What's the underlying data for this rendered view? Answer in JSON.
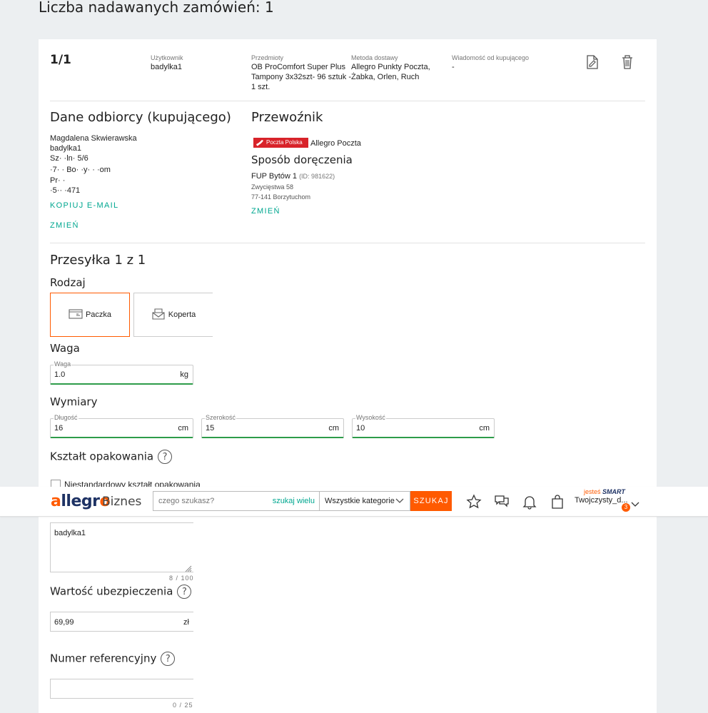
{
  "page_title": "Liczba nadawanych zamówień: 1",
  "order": {
    "index": "1/1",
    "user_label": "Użytkownik",
    "user_value": "badylka1",
    "items_label": "Przedmioty",
    "items_value_1": "OB ProComfort Super Plus",
    "items_value_2": "Tampony 3x32szt- 96 sztuk -",
    "items_value_3": "1 szt.",
    "delivery_label": "Metoda dostawy",
    "delivery_value_1": "Allegro Punkty Poczta,",
    "delivery_value_2": "Żabka, Orlen, Ruch",
    "message_label": "Wiadomość od kupującego",
    "message_value": "-"
  },
  "recipient": {
    "heading": "Dane odbiorcy (kupującego)",
    "name": "Magdalena Skwierawska",
    "login": "badylka1",
    "line_street": "Sz· ·ln· 5/6",
    "line_city": "·7· · Bo· ·y· · ·om",
    "line_country": "Pr· ·",
    "line_phone": "·5·· ·471",
    "copy_email": "KOPIUJ E-MAIL",
    "change": "ZMIEŃ"
  },
  "carrier": {
    "heading": "Przewoźnik",
    "logo_text": "Poczta Polska",
    "name": "Allegro Poczta",
    "method_heading": "Sposób doręczenia",
    "point_name": "FUP Bytów 1",
    "point_id": "(ID: 981622)",
    "point_street": "Zwycięstwa 58",
    "point_city": "77-141 Borzytuchom",
    "change": "ZMIEŃ"
  },
  "shipment": {
    "heading": "Przesyłka 1 z 1",
    "type_heading": "Rodzaj",
    "type_parcel": "Paczka",
    "type_envelope": "Koperta",
    "weight_heading": "Waga",
    "weight_label": "Waga",
    "weight_value": "1.0",
    "weight_unit": "kg",
    "dims_heading": "Wymiary",
    "length_label": "Długość",
    "length_value": "16",
    "width_label": "Szerokość",
    "width_value": "15",
    "height_label": "Wysokość",
    "height_value": "10",
    "dim_unit": "cm",
    "shape_heading": "Kształt opakowania",
    "nonstandard_label": "Niestandardowy kształt opakowania",
    "note_value": "badylka1",
    "note_counter": "8 / 100",
    "insurance_heading": "Wartość ubezpieczenia",
    "insurance_value": "69,99",
    "insurance_unit": "zł",
    "reference_heading": "Numer referencyjny",
    "reference_counter": "0 / 25",
    "help_icon": "?"
  },
  "navbar": {
    "logo": "allegro",
    "biznes": "Biznes",
    "search_placeholder": "czego szukasz?",
    "search_multi": "szukaj wielu",
    "category": "Wszystkie kategorie",
    "search_button": "SZUKAJ",
    "smart_prefix": "jesteś",
    "smart_word": "SMART",
    "user": "Twojczysty_d...",
    "badge": "3"
  },
  "colors": {
    "accent": "#00a790",
    "brand": "#ff5a00",
    "valid": "#2e9c4a"
  }
}
